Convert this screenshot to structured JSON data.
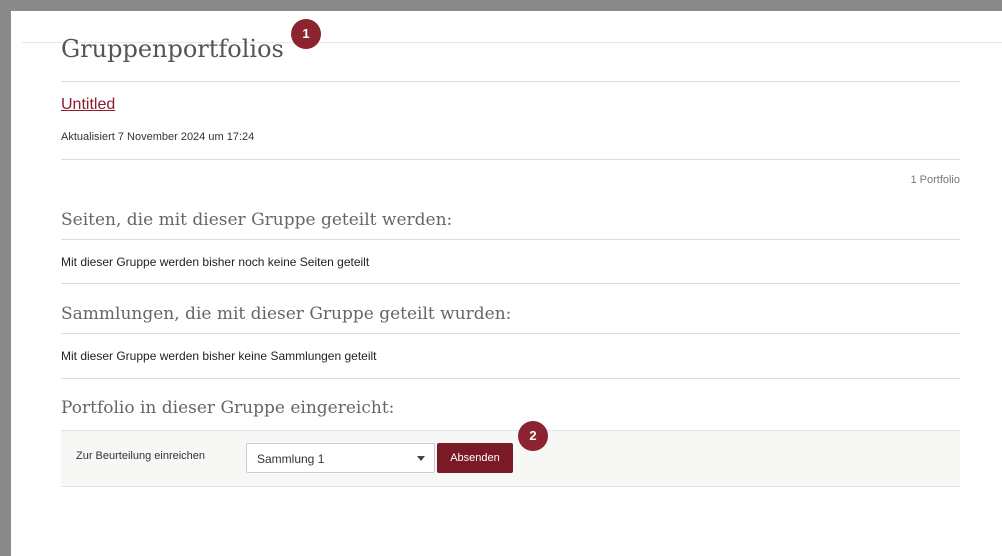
{
  "page": {
    "title": "Gruppenportfolios"
  },
  "portfolio": {
    "link_text": "Untitled",
    "updated": "Aktualisiert 7 November 2024 um 17:24",
    "count": "1 Portfolio"
  },
  "pages_section": {
    "title": "Seiten, die mit dieser Gruppe geteilt werden:",
    "text": "Mit dieser Gruppe werden bisher noch keine Seiten geteilt"
  },
  "collections_section": {
    "title": "Sammlungen, die mit dieser Gruppe geteilt wurden:",
    "text": "Mit dieser Gruppe werden bisher keine Sammlungen geteilt"
  },
  "submitted_section": {
    "title": "Portfolio in dieser Gruppe eingereicht:",
    "submit_label": "Zur Beurteilung einreichen",
    "select_value": "Sammlung 1",
    "button_label": "Absenden"
  },
  "annotations": {
    "badge_1": "1",
    "badge_2": "2"
  },
  "colors": {
    "accent": "#7a1a26",
    "badge": "#8b2330",
    "link": "#8b1e2c"
  }
}
